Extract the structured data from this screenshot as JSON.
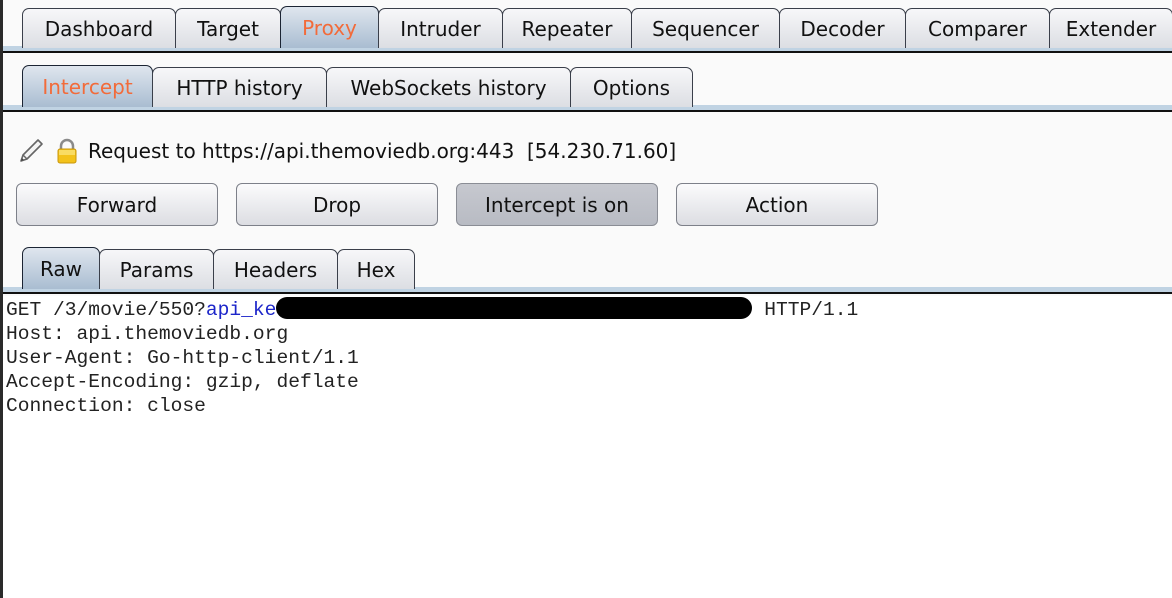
{
  "main_tabs": [
    {
      "label": "Dashboard",
      "active": false
    },
    {
      "label": "Target",
      "active": false
    },
    {
      "label": "Proxy",
      "active": true
    },
    {
      "label": "Intruder",
      "active": false
    },
    {
      "label": "Repeater",
      "active": false
    },
    {
      "label": "Sequencer",
      "active": false
    },
    {
      "label": "Decoder",
      "active": false
    },
    {
      "label": "Comparer",
      "active": false
    },
    {
      "label": "Extender",
      "active": false
    }
  ],
  "proxy_tabs": [
    {
      "label": "Intercept",
      "active": true
    },
    {
      "label": "HTTP history",
      "active": false
    },
    {
      "label": "WebSockets history",
      "active": false
    },
    {
      "label": "Options",
      "active": false
    }
  ],
  "intercept": {
    "edit_icon": "pencil-icon",
    "lock_icon": "lock-icon",
    "request_info": "Request to https://api.themoviedb.org:443  [54.230.71.60]",
    "buttons": {
      "forward": "Forward",
      "drop": "Drop",
      "intercept_toggle": "Intercept is on",
      "action": "Action"
    }
  },
  "editor_tabs": [
    {
      "label": "Raw",
      "active": true
    },
    {
      "label": "Params",
      "active": false
    },
    {
      "label": "Headers",
      "active": false
    },
    {
      "label": "Hex",
      "active": false
    }
  ],
  "request": {
    "line1_prefix": "GET /3/movie/550?",
    "line1_param": "api_ke",
    "line1_suffix": " HTTP/1.1",
    "redacted_note": "[redacted]",
    "headers": [
      "Host: api.themoviedb.org",
      "User-Agent: Go-http-client/1.1",
      "Accept-Encoding: gzip, deflate",
      "Connection: close"
    ]
  },
  "colors": {
    "active_tab_text": "#f26b3a",
    "param_name": "#1c25c9"
  }
}
